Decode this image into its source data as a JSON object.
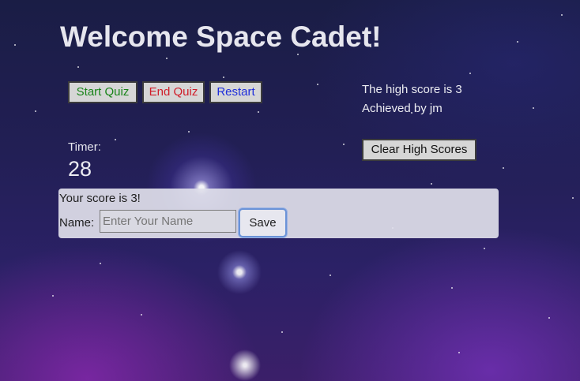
{
  "header": {
    "title": "Welcome Space Cadet!"
  },
  "controls": {
    "start_label": "Start Quiz",
    "end_label": "End Quiz",
    "restart_label": "Restart",
    "clear_label": "Clear High Scores"
  },
  "high_score": {
    "line": "The high score is 3",
    "achiever": "Achieved by jm"
  },
  "timer": {
    "label": "Timer:",
    "value": "28"
  },
  "result": {
    "message": "Your score is 3!",
    "name_label": "Name:",
    "name_value": "",
    "name_placeholder": "Enter Your Name",
    "save_label": "Save"
  },
  "colors": {
    "start": "#188418",
    "end": "#d01e2a",
    "restart": "#1f2edb",
    "panel": "#e0e0ea"
  }
}
